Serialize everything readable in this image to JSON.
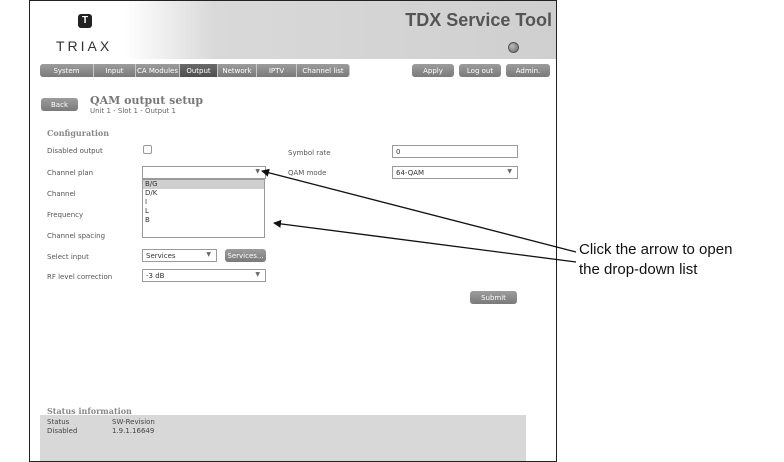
{
  "header": {
    "logo_glyph": "T",
    "logo_text": "TRIAX",
    "app_title": "TDX Service Tool"
  },
  "nav": {
    "tabs": [
      {
        "label": "System",
        "w": 54
      },
      {
        "label": "Input",
        "w": 42
      },
      {
        "label": "CA Modules",
        "w": 44
      },
      {
        "label": "Output",
        "w": 38,
        "active": true
      },
      {
        "label": "Network",
        "w": 39
      },
      {
        "label": "IPTV",
        "w": 40
      },
      {
        "label": "Channel list",
        "w": 53
      }
    ],
    "apply_label": "Apply",
    "logout_label": "Log out",
    "admin_label": "Admin."
  },
  "page": {
    "back_label": "Back",
    "title": "QAM  output setup",
    "subtitle": "Unit 1 - Slot 1 - Output 1"
  },
  "config": {
    "section_title": "Configuration",
    "disabled_output_label": "Disabled output",
    "channel_plan_label": "Channel plan",
    "channel_label": "Channel",
    "frequency_label": "Frequency",
    "channel_spacing_label": "Channel spacing",
    "select_input_label": "Select input",
    "select_input_value": "Services",
    "services_button": "Services...",
    "rf_level_label": "RF level correction",
    "rf_level_value": "-3 dB",
    "symbol_rate_label": "Symbol rate",
    "symbol_rate_value": "0",
    "qam_mode_label": "QAM mode",
    "qam_mode_value": "64-QAM",
    "channel_plan_options": [
      "B/G",
      "D/K",
      "I",
      "L",
      "B"
    ],
    "submit_label": "Submit"
  },
  "status": {
    "title": "Status information",
    "col1_header": "Status",
    "col2_header": "SW-Revision",
    "col1_value": "Disabled",
    "col2_value": "1.9.1.16649"
  },
  "annotation": {
    "line1": "Click the arrow to open",
    "line2": "the drop-down list"
  }
}
